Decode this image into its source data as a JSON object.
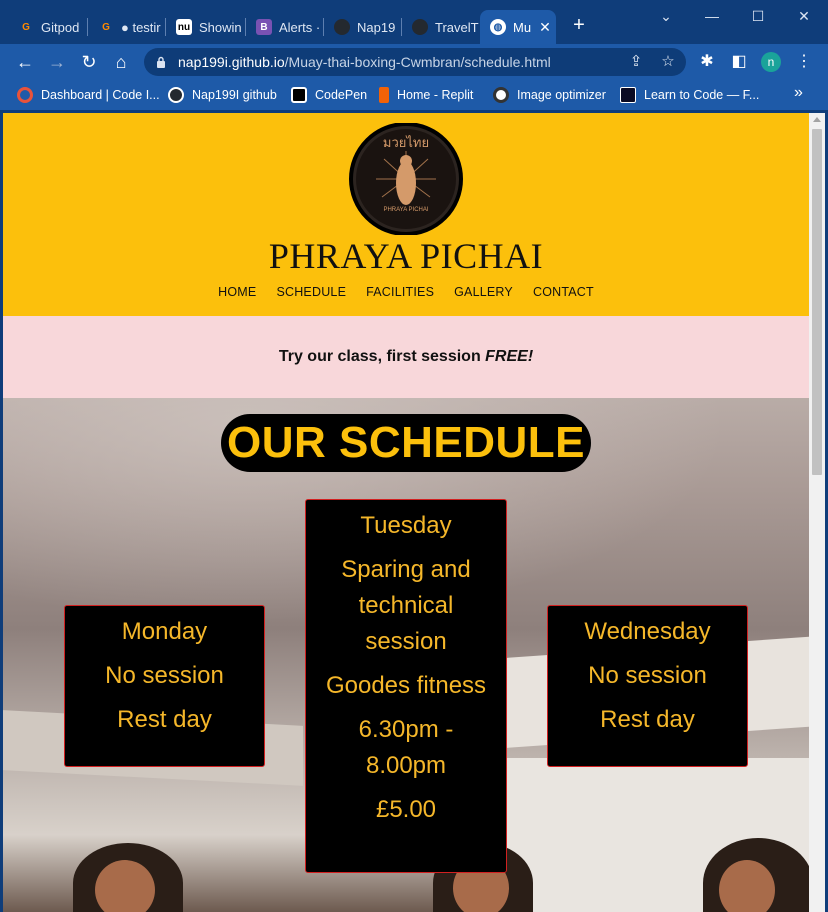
{
  "browser": {
    "tabs": [
      {
        "label": "Gitpod",
        "icon": "gitpod-icon"
      },
      {
        "label": "● testir",
        "icon": "gitpod-icon"
      },
      {
        "label": "Showin",
        "icon": "nu-icon"
      },
      {
        "label": "Alerts ·",
        "icon": "bootstrap-icon"
      },
      {
        "label": "Nap19",
        "icon": "github-icon"
      },
      {
        "label": "TravelT",
        "icon": "github-icon"
      },
      {
        "label": "Mu",
        "icon": "globe-icon"
      }
    ],
    "url_host": "nap199i.github.io",
    "url_path": "/Muay-thai-boxing-Cwmbran/schedule.html",
    "profile_initial": "n",
    "bookmarks": [
      {
        "label": "Dashboard | Code I...",
        "icon": "code-institute-icon"
      },
      {
        "label": "Nap199I github",
        "icon": "github-icon"
      },
      {
        "label": "CodePen",
        "icon": "codepen-icon"
      },
      {
        "label": "Home - Replit",
        "icon": "replit-icon"
      },
      {
        "label": "Image optimizer",
        "icon": "panda-icon"
      },
      {
        "label": "Learn to Code — F...",
        "icon": "freecodecamp-icon"
      }
    ]
  },
  "site": {
    "logo_thai": "มวยไทย",
    "logo_caption": "PHRAYA   PICHAI",
    "title": "PHRAYA PICHAI",
    "nav": [
      "HOME",
      "SCHEDULE",
      "FACILITIES",
      "GALLERY",
      "CONTACT"
    ],
    "promo_prefix": "Try our class, first session ",
    "promo_emphasis": "FREE!",
    "schedule_heading": "OUR SCHEDULE",
    "days": [
      {
        "day": "Monday",
        "lines": [
          "No session",
          "Rest day"
        ]
      },
      {
        "day": "Tuesday",
        "lines": [
          "Sparing and technical session",
          "Goodes fitness",
          "6.30pm - 8.00pm",
          "£5.00"
        ]
      },
      {
        "day": "Wednesday",
        "lines": [
          "No session",
          "Rest day"
        ]
      }
    ]
  },
  "colors": {
    "brand_yellow": "#fcc00c",
    "promo_pink": "#f8d7da",
    "card_text": "#f5b72a",
    "card_border": "#d22020",
    "chrome_dark": "#0f3d7a",
    "chrome_light": "#1e5aa8"
  }
}
